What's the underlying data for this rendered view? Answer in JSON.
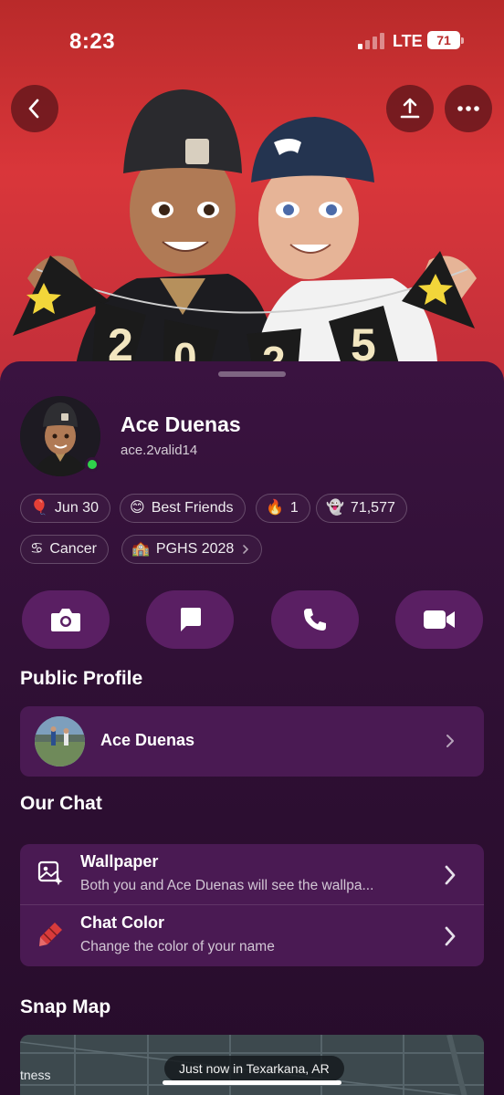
{
  "status_bar": {
    "time": "8:23",
    "network": "LTE",
    "battery": "71"
  },
  "hero": {
    "back_icon": "chevron-left-icon",
    "share_icon": "share-upload-icon",
    "more_icon": "more-dots-icon",
    "banner_letters": [
      "2",
      "0",
      "2",
      "5"
    ]
  },
  "profile": {
    "display_name": "Ace Duenas",
    "username": "ace.2valid14",
    "online": true
  },
  "chips": [
    {
      "icon": "balloon-icon",
      "glyph": "🎈",
      "label": "Jun 30"
    },
    {
      "icon": "smile-icon",
      "glyph": "😊",
      "label": "Best Friends"
    },
    {
      "icon": "fire-icon",
      "glyph": "🔥",
      "label": "1"
    },
    {
      "icon": "ghost-icon",
      "glyph": "👻",
      "label": "71,577"
    },
    {
      "icon": "zodiac-cancer-icon",
      "glyph": "♋",
      "label": "Cancer"
    },
    {
      "icon": "school-icon",
      "glyph": "🏫",
      "label": "PGHS 2028"
    }
  ],
  "actions": [
    {
      "icon": "camera-icon"
    },
    {
      "icon": "chat-icon"
    },
    {
      "icon": "phone-icon"
    },
    {
      "icon": "video-icon"
    }
  ],
  "public_profile": {
    "title": "Public Profile",
    "name": "Ace Duenas"
  },
  "our_chat": {
    "title": "Our Chat",
    "wallpaper": {
      "title": "Wallpaper",
      "subtitle": "Both you and Ace Duenas will see the wallpa..."
    },
    "chat_color": {
      "title": "Chat Color",
      "subtitle": "Change the color of your name"
    }
  },
  "snap_map": {
    "title": "Snap Map",
    "edge_label": "tness",
    "location_text": "Just now in Texarkana, AR"
  },
  "colors": {
    "hero_red": "#d9363a",
    "sheet_purple": "#3a1340",
    "card_purple": "#4a1a53",
    "button_purple": "#5a1f63",
    "online_green": "#2fd14b"
  }
}
